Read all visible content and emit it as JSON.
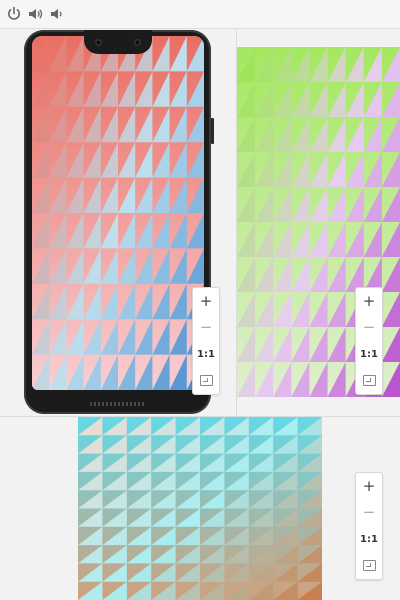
{
  "toolbar": {
    "icons": [
      "power-icon",
      "volume-up-icon",
      "volume-down-icon"
    ]
  },
  "panes": [
    {
      "name": "phone-preview",
      "device_frame": "phone",
      "cols": 10,
      "rows": 10,
      "gradient": {
        "start": "#e8756a",
        "mid": "#bfe0ee",
        "end": "#4a8ed0",
        "solid_top": "#e96e63",
        "solid_bottom": "#f7cfd3"
      }
    },
    {
      "name": "violet-green-preview",
      "cols": 9,
      "rows": 10,
      "gradient": {
        "start": "#9ee55a",
        "mid": "#e8cdf1",
        "end": "#b956cf",
        "solid_top": "#a4e860",
        "solid_bottom": "#dfefcf"
      }
    },
    {
      "name": "cyan-orange-preview",
      "cols": 10,
      "rows": 10,
      "gradient": {
        "start": "#e7ddd5",
        "mid": "#a8eef2",
        "end": "#c97f4e",
        "solid_top": "#63d9e5",
        "solid_bottom": "#d0a07e"
      }
    }
  ],
  "zoom_controls": {
    "zoom_in_label": "+",
    "zoom_out_label": "−",
    "actual_size_label": "1:1",
    "fit_icon": "fit-screen-icon"
  }
}
